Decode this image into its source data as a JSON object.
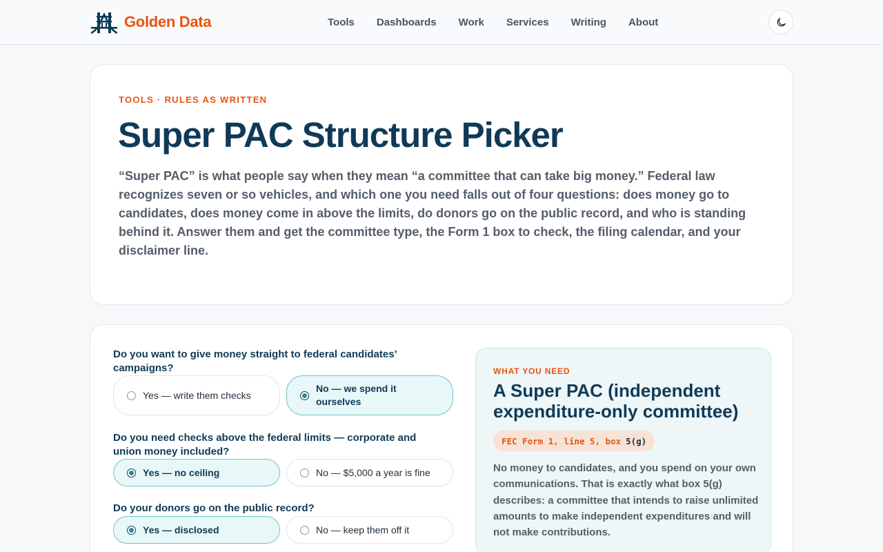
{
  "header": {
    "brand": "Golden Data",
    "nav": [
      "Tools",
      "Dashboards",
      "Work",
      "Services",
      "Writing",
      "About"
    ],
    "theme_toggle_icon": "moon-icon"
  },
  "intro": {
    "eyebrow": "TOOLS · RULES AS WRITTEN",
    "title": "Super PAC Structure Picker",
    "lede": "“Super PAC” is what people say when they mean “a committee that can take big money.” Federal law recognizes seven or so vehicles, and which one you need falls out of four questions: does money go to candidates, does money come in above the limits, do donors go on the public record, and who is standing behind it. Answer them and get the committee type, the Form 1 box to check, the filing calendar, and your disclaimer line."
  },
  "questions": [
    {
      "question": "Do you want to give money straight to federal candidates’ campaigns?",
      "options": [
        {
          "label": "Yes — write them checks",
          "selected": false
        },
        {
          "label": "No — we spend it ourselves",
          "selected": true
        }
      ]
    },
    {
      "question": "Do you need checks above the federal limits — corporate and union money included?",
      "options": [
        {
          "label": "Yes — no ceiling",
          "selected": true
        },
        {
          "label": "No — $5,000 a year is fine",
          "selected": false
        }
      ]
    },
    {
      "question": "Do your donors go on the public record?",
      "options": [
        {
          "label": "Yes — disclosed",
          "selected": true
        },
        {
          "label": "No — keep them off it",
          "selected": false
        }
      ]
    }
  ],
  "result": {
    "eyebrow": "WHAT YOU NEED",
    "title": "A Super PAC (independent expenditure-only committee)",
    "form_ref": "FEC Form 1, line 5, box",
    "form_box": "5(g)",
    "body": "No money to candidates, and you spend on your own communications. That is exactly what box 5(g) describes: a committee that intends to raise unlimited amounts to make independent expenditures and will not make contributions."
  },
  "colors": {
    "accent": "#e8540f",
    "navy": "#0f3a57",
    "selected_bg": "#e8f7f7",
    "selected_border": "#6fc4c6"
  }
}
